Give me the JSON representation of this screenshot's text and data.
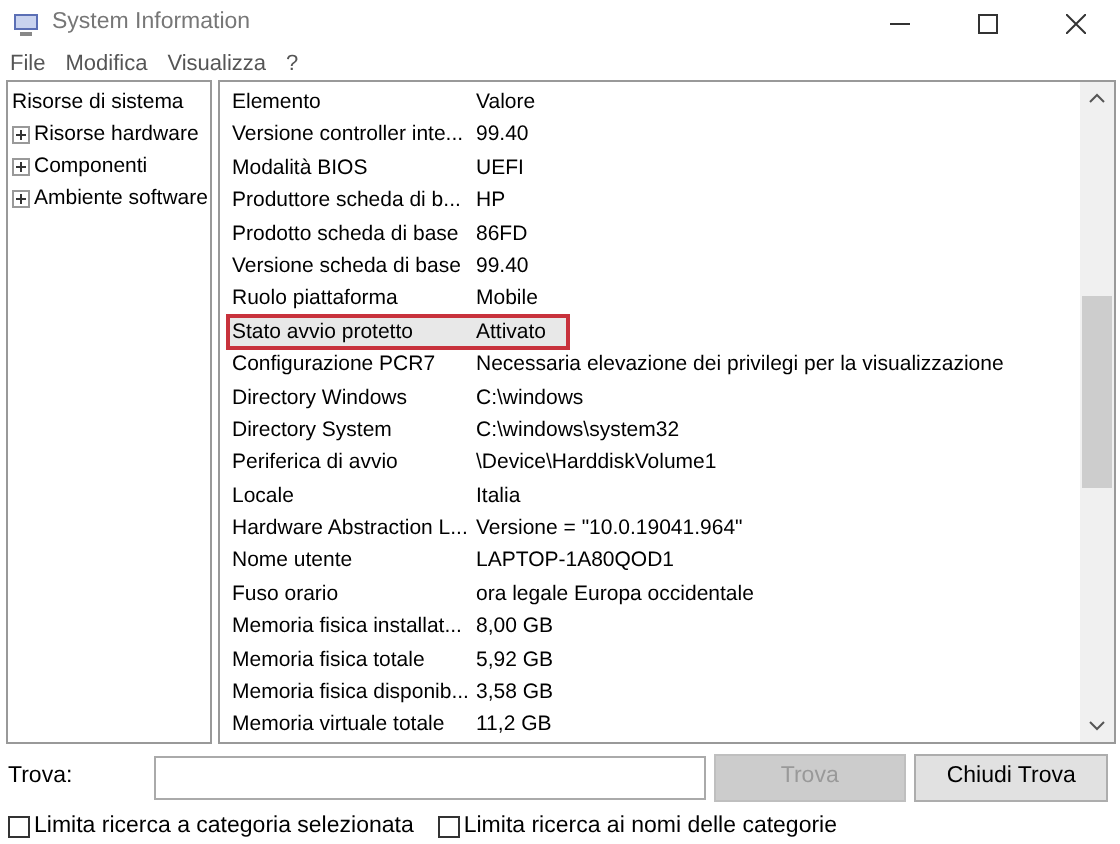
{
  "window": {
    "title": "System Information"
  },
  "menu": [
    "File",
    "Modifica",
    "Visualizza",
    "?"
  ],
  "tree": {
    "label": "Risorse di sistema",
    "selected": false,
    "children": [
      {
        "label": "Risorse hardware",
        "expanded": false
      },
      {
        "label": "Componenti",
        "expanded": false
      },
      {
        "label": "Ambiente software",
        "expanded": false
      }
    ]
  },
  "table": {
    "columns": [
      "Elemento",
      "Valore"
    ],
    "rows": [
      {
        "cells": [
          "Versione controller inte...",
          "99.40"
        ],
        "selected": false,
        "outlined": false
      },
      {
        "cells": [
          "Modalità BIOS",
          "UEFI"
        ],
        "selected": false,
        "outlined": false
      },
      {
        "cells": [
          "Produttore scheda di b...",
          "HP"
        ],
        "selected": false,
        "outlined": false
      },
      {
        "cells": [
          "Prodotto scheda di base",
          "86FD"
        ],
        "selected": false,
        "outlined": false
      },
      {
        "cells": [
          "Versione scheda di base",
          "99.40"
        ],
        "selected": false,
        "outlined": false
      },
      {
        "cells": [
          "Ruolo piattaforma",
          "Mobile"
        ],
        "selected": false,
        "outlined": false
      },
      {
        "cells": [
          "Stato avvio protetto",
          "Attivato"
        ],
        "selected": true,
        "outlined": true
      },
      {
        "cells": [
          "Configurazione PCR7",
          "Necessaria elevazione dei privilegi per la visualizzazione"
        ],
        "selected": false,
        "outlined": false
      },
      {
        "cells": [
          "Directory Windows",
          "C:\\windows"
        ],
        "selected": false,
        "outlined": false
      },
      {
        "cells": [
          "Directory System",
          "C:\\windows\\system32"
        ],
        "selected": false,
        "outlined": false
      },
      {
        "cells": [
          "Periferica di avvio",
          "\\Device\\HarddiskVolume1"
        ],
        "selected": false,
        "outlined": false
      },
      {
        "cells": [
          "Locale",
          "Italia"
        ],
        "selected": false,
        "outlined": false
      },
      {
        "cells": [
          "Hardware Abstraction L...",
          "Versione = \"10.0.19041.964\""
        ],
        "selected": false,
        "outlined": false
      },
      {
        "cells": [
          "Nome utente",
          "LAPTOP-1A80QOD1"
        ],
        "selected": false,
        "outlined": false
      },
      {
        "cells": [
          "Fuso orario",
          "ora legale Europa occidentale"
        ],
        "selected": false,
        "outlined": false
      },
      {
        "cells": [
          "Memoria fisica installat...",
          "8,00 GB"
        ],
        "selected": false,
        "outlined": false
      },
      {
        "cells": [
          "Memoria fisica totale",
          "5,92 GB"
        ],
        "selected": false,
        "outlined": false
      },
      {
        "cells": [
          "Memoria fisica disponib...",
          "3,58 GB"
        ],
        "selected": false,
        "outlined": false
      },
      {
        "cells": [
          "Memoria virtuale totale",
          "11,2 GB"
        ],
        "selected": false,
        "outlined": false
      }
    ]
  },
  "find": {
    "label": "Trova:",
    "buttons": [
      {
        "label": "Trova",
        "disabled": true
      },
      {
        "label": "Chiudi Trova",
        "disabled": false
      }
    ],
    "options": [
      {
        "label": "Limita ricerca a categoria selezionata",
        "checked": false
      },
      {
        "label": "Limita ricerca ai nomi delle categorie",
        "checked": false
      }
    ]
  }
}
